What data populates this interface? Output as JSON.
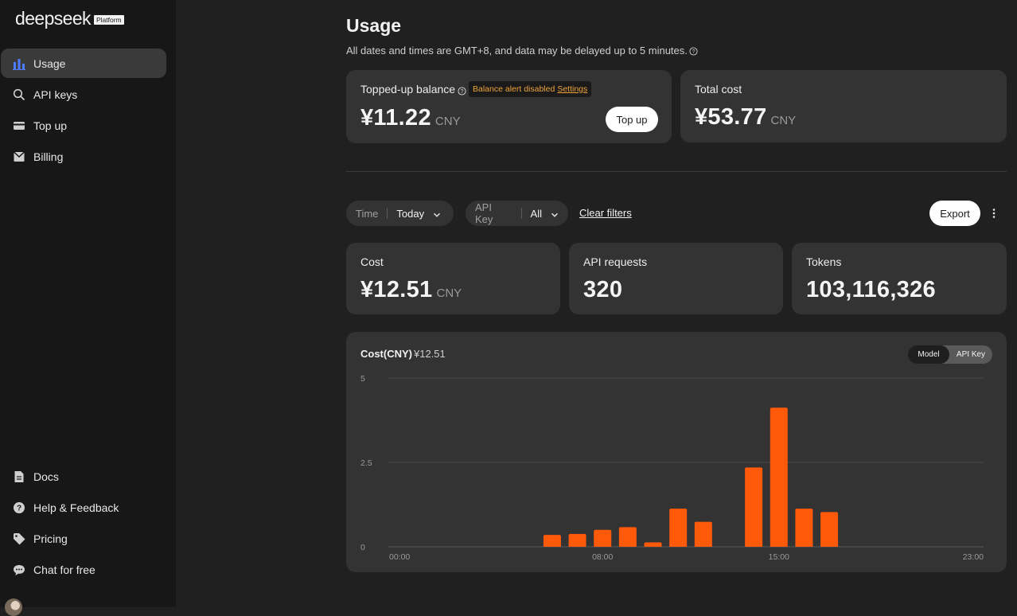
{
  "brand": {
    "name": "deepseek",
    "badge": "Platform"
  },
  "nav": {
    "top": [
      {
        "label": "Usage",
        "icon": "bar-chart-icon",
        "active": true
      },
      {
        "label": "API keys",
        "icon": "search-icon",
        "active": false
      },
      {
        "label": "Top up",
        "icon": "card-icon",
        "active": false
      },
      {
        "label": "Billing",
        "icon": "billing-icon",
        "active": false
      }
    ],
    "bottom": [
      {
        "label": "Docs",
        "icon": "docs-icon"
      },
      {
        "label": "Help & Feedback",
        "icon": "help-icon"
      },
      {
        "label": "Pricing",
        "icon": "tag-icon"
      },
      {
        "label": "Chat for free",
        "icon": "chat-icon"
      }
    ]
  },
  "page": {
    "title": "Usage",
    "subtitle": "All dates and times are GMT+8, and data may be delayed up to 5 minutes."
  },
  "balance": {
    "label": "Topped-up balance",
    "alert": "Balance alert disabled",
    "alert_link": "Settings",
    "amount": "¥11.22",
    "unit": "CNY",
    "topup_label": "Top up"
  },
  "total_cost": {
    "label": "Total cost",
    "amount": "¥53.77",
    "unit": "CNY"
  },
  "filters": {
    "time_label": "Time",
    "time_value": "Today",
    "key_label": "API Key",
    "key_value": "All",
    "clear_label": "Clear filters",
    "export_label": "Export"
  },
  "stats": {
    "cost": {
      "label": "Cost",
      "amount": "¥12.51",
      "unit": "CNY"
    },
    "requests": {
      "label": "API requests",
      "value": "320"
    },
    "tokens": {
      "label": "Tokens",
      "value": "103,116,326"
    }
  },
  "chart_panel": {
    "title": "Cost(CNY)",
    "total": "¥12.51",
    "toggle": [
      "Model",
      "API Key"
    ],
    "active_toggle": "Model"
  },
  "colors": {
    "bar": "#ff5a0a",
    "accent_warning": "#f0a43a"
  },
  "chart_data": {
    "type": "bar",
    "title": "Cost(CNY)",
    "categories": [
      "00:00",
      "01:00",
      "02:00",
      "03:00",
      "04:00",
      "05:00",
      "06:00",
      "07:00",
      "08:00",
      "09:00",
      "10:00",
      "11:00",
      "12:00",
      "13:00",
      "14:00",
      "15:00",
      "16:00",
      "17:00",
      "18:00",
      "19:00",
      "20:00",
      "21:00",
      "22:00",
      "23:00"
    ],
    "values": [
      0,
      0,
      0,
      0,
      0,
      0,
      0.35,
      0.38,
      0.5,
      0.58,
      0.13,
      1.13,
      0.74,
      0,
      2.35,
      4.12,
      1.13,
      1.03,
      0,
      0,
      0,
      0,
      0,
      0
    ],
    "x_tick_labels": [
      "00:00",
      "08:00",
      "15:00",
      "23:00"
    ],
    "y_ticks": [
      0,
      2.5,
      5
    ],
    "ylim": [
      0,
      5
    ],
    "grid": true
  }
}
